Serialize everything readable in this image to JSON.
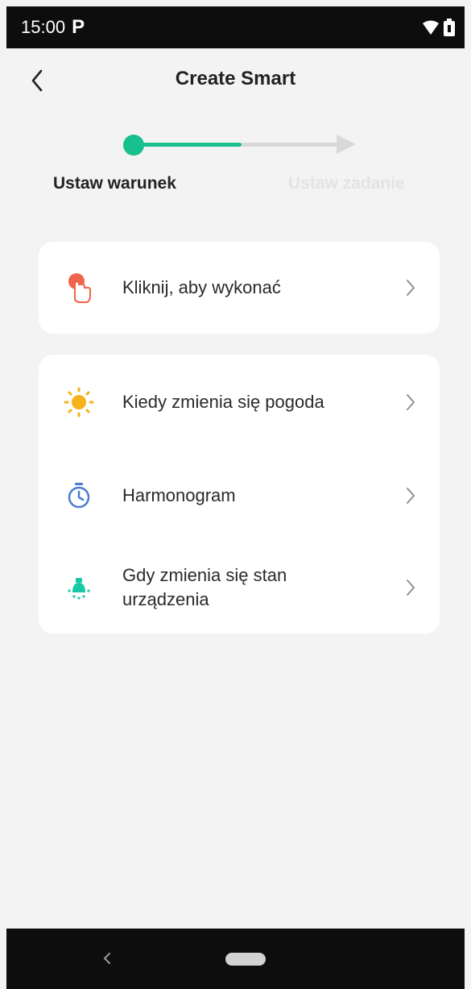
{
  "status_bar": {
    "time": "15:00",
    "app_glyph": "P"
  },
  "header": {
    "title": "Create Smart"
  },
  "stepper": {
    "step1": "Ustaw warunek",
    "step2": "Ustaw zadanie"
  },
  "conditions": {
    "tap": "Kliknij, aby wykonać",
    "weather": "Kiedy zmienia się pogoda",
    "schedule": "Harmonogram",
    "device_line1": "Gdy zmienia się stan",
    "device_line2": "urządzenia"
  },
  "colors": {
    "accent": "#17c08c",
    "tap_icon": "#f0644a",
    "weather_icon": "#f5b21b",
    "schedule_icon": "#4a7bd0",
    "device_icon": "#17c9a6"
  },
  "icons": [
    "tap-hand-icon",
    "sun-icon",
    "timer-icon",
    "device-bulb-icon",
    "chevron-right-icon"
  ]
}
